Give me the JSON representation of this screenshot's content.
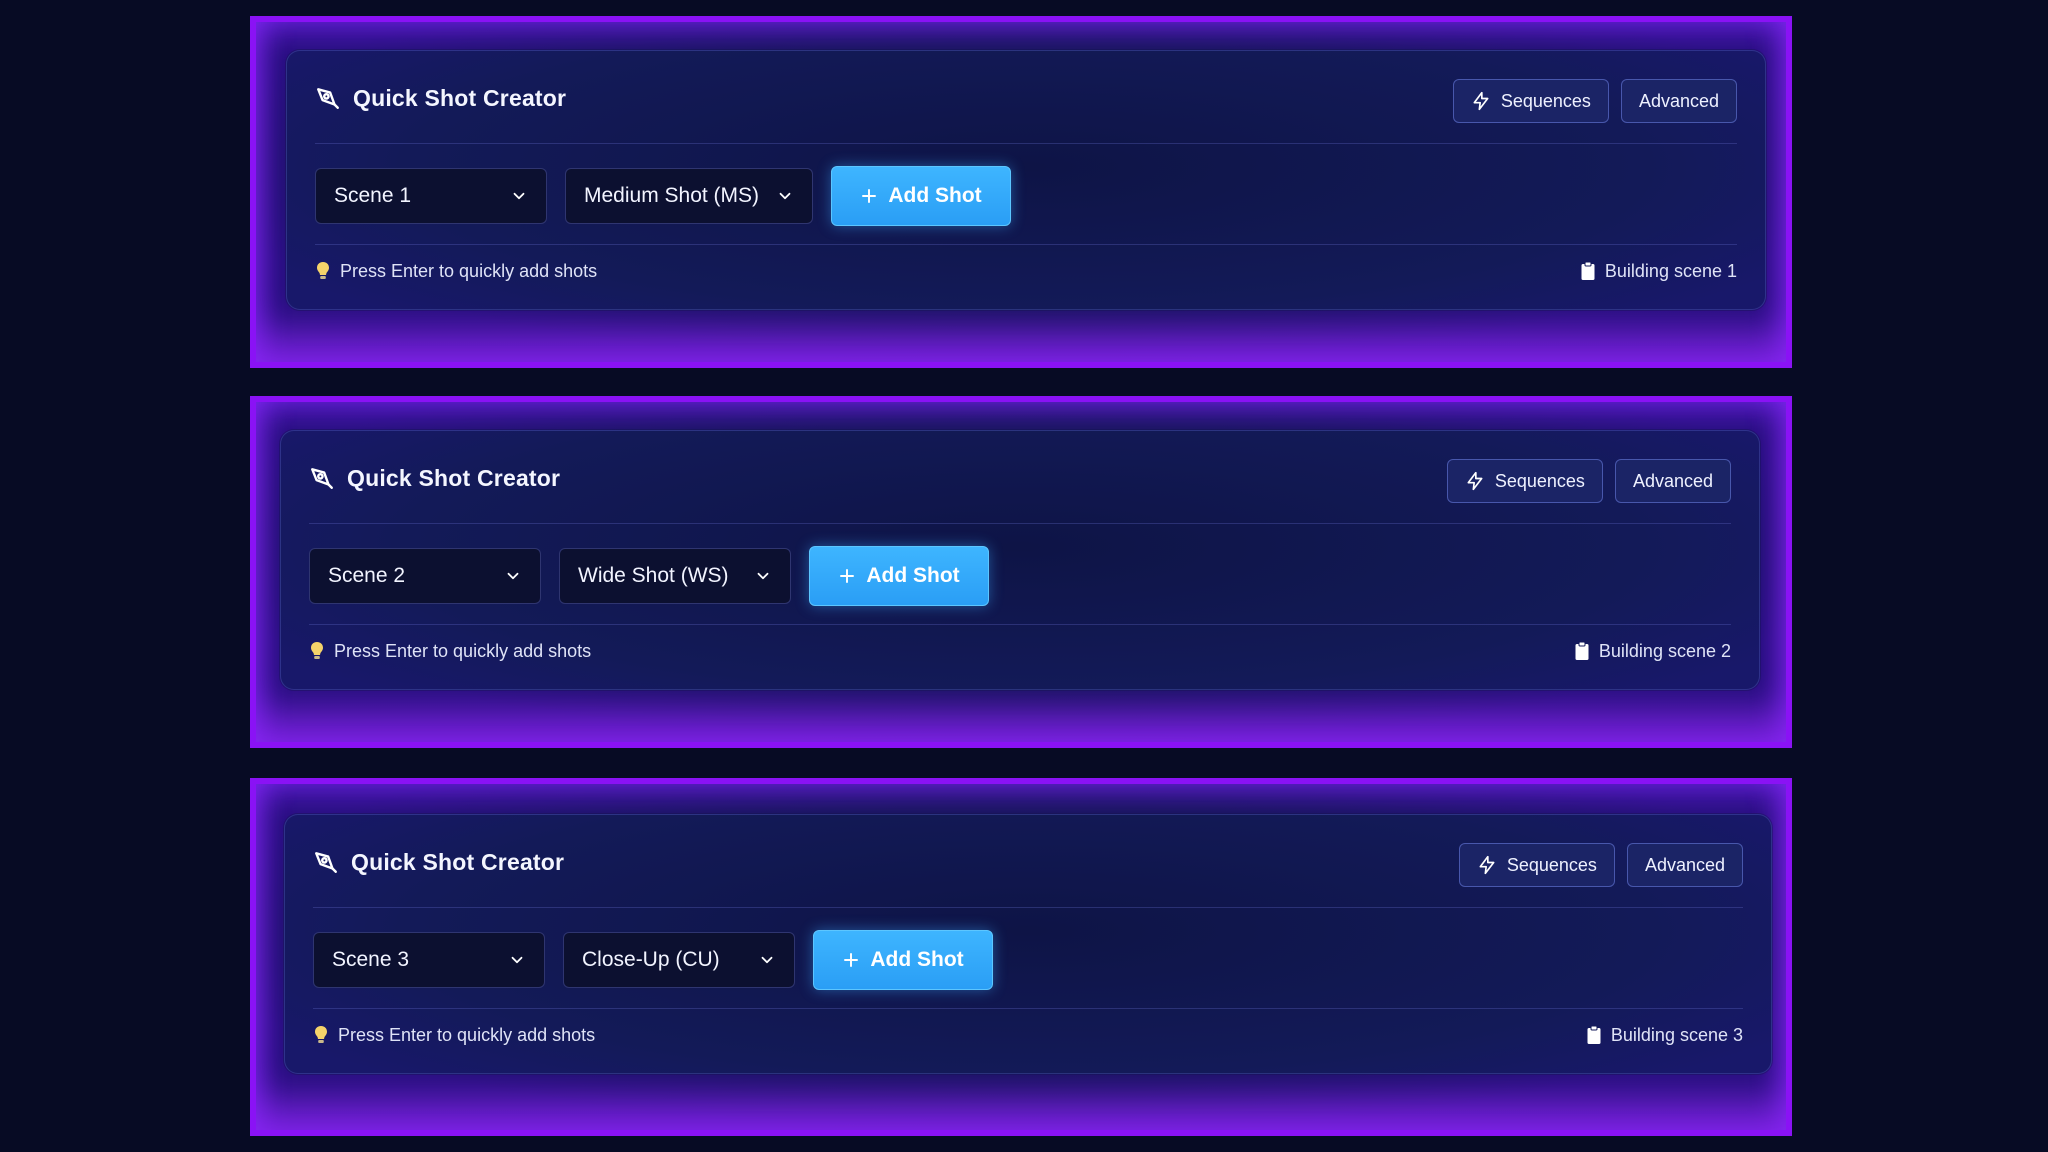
{
  "panels": [
    {
      "title": "Quick Shot Creator",
      "sequences_label": "Sequences",
      "advanced_label": "Advanced",
      "scene_value": "Scene 1",
      "shot_type_value": "Medium Shot (MS)",
      "add_label": "Add Shot",
      "hint": "Press Enter to quickly add shots",
      "status": "Building scene 1"
    },
    {
      "title": "Quick Shot Creator",
      "sequences_label": "Sequences",
      "advanced_label": "Advanced",
      "scene_value": "Scene 2",
      "shot_type_value": "Wide Shot (WS)",
      "add_label": "Add Shot",
      "hint": "Press Enter to quickly add shots",
      "status": "Building scene 2"
    },
    {
      "title": "Quick Shot Creator",
      "sequences_label": "Sequences",
      "advanced_label": "Advanced",
      "scene_value": "Scene 3",
      "shot_type_value": "Close-Up (CU)",
      "add_label": "Add Shot",
      "hint": "Press Enter to quickly add shots",
      "status": "Building scene 3"
    }
  ],
  "icons": {
    "title": "pen-tool-icon",
    "sequences": "lightning-icon",
    "dropdown": "chevron-down-icon",
    "add": "plus-icon",
    "hint": "lightbulb-icon",
    "status": "clipboard-icon"
  },
  "colors": {
    "background": "#070b24",
    "panel_border": "#8a12f5",
    "card": "#131a58",
    "accent": "#3eb5ff",
    "hint_icon": "#f5d36a"
  }
}
